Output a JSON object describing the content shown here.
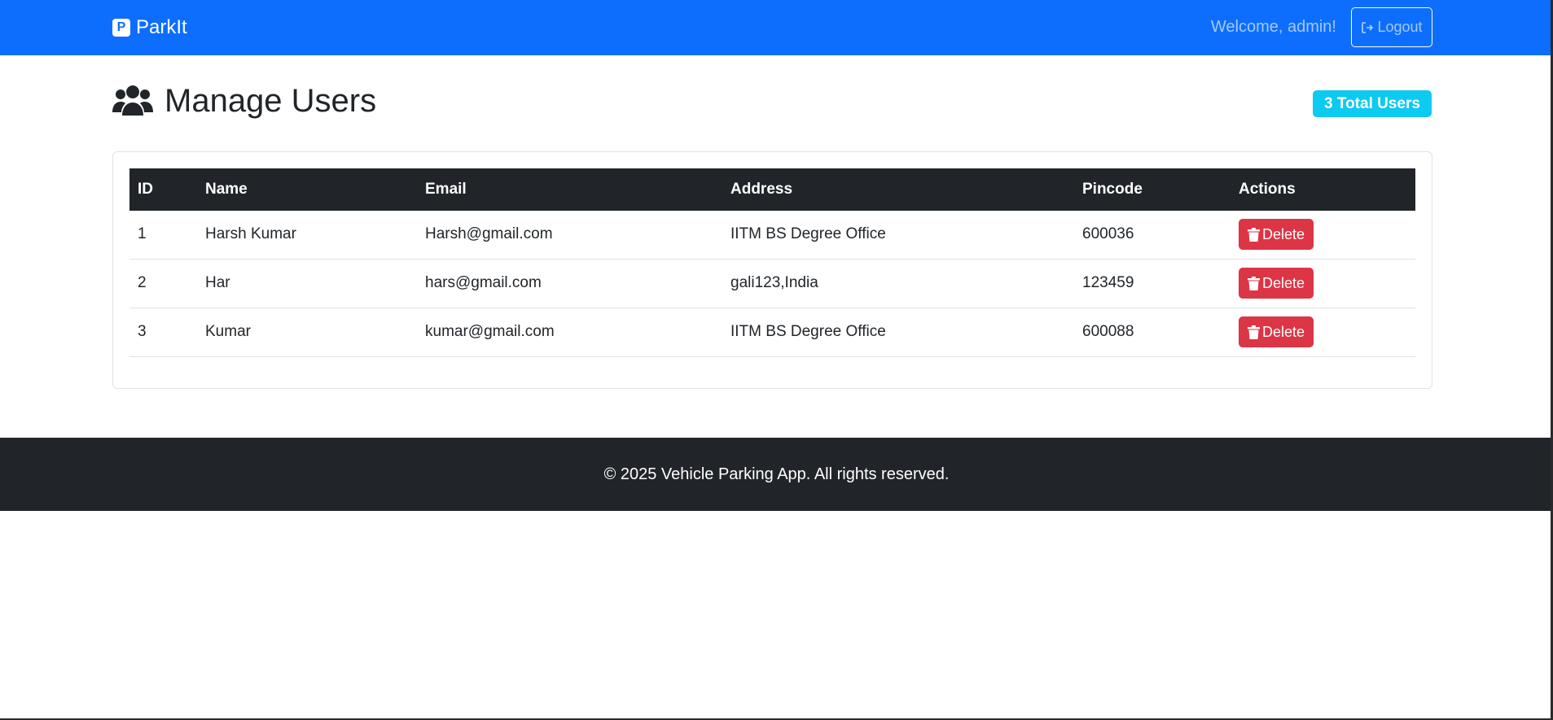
{
  "navbar": {
    "brand": "ParkIt",
    "brand_icon": "parking-icon",
    "welcome": "Welcome, admin!",
    "logout_label": "Logout",
    "color": "#0d6efd"
  },
  "header": {
    "title": "Manage Users",
    "icon": "users-icon",
    "badge": "3 Total Users"
  },
  "table": {
    "columns": [
      "ID",
      "Name",
      "Email",
      "Address",
      "Pincode",
      "Actions"
    ],
    "rows": [
      {
        "id": "1",
        "name": "Harsh Kumar",
        "email": "Harsh@gmail.com",
        "address": "IITM BS Degree Office",
        "pincode": "600036",
        "action": "Delete"
      },
      {
        "id": "2",
        "name": "Har",
        "email": "hars@gmail.com",
        "address": "gali123,India",
        "pincode": "123459",
        "action": "Delete"
      },
      {
        "id": "3",
        "name": "Kumar",
        "email": "kumar@gmail.com",
        "address": "IITM BS Degree Office",
        "pincode": "600088",
        "action": "Delete"
      }
    ]
  },
  "footer": {
    "text": "© 2025 Vehicle Parking App. All rights reserved."
  },
  "colors": {
    "primary": "#0d6efd",
    "danger": "#dc3545",
    "info": "#0dcaf0",
    "dark": "#212529"
  }
}
